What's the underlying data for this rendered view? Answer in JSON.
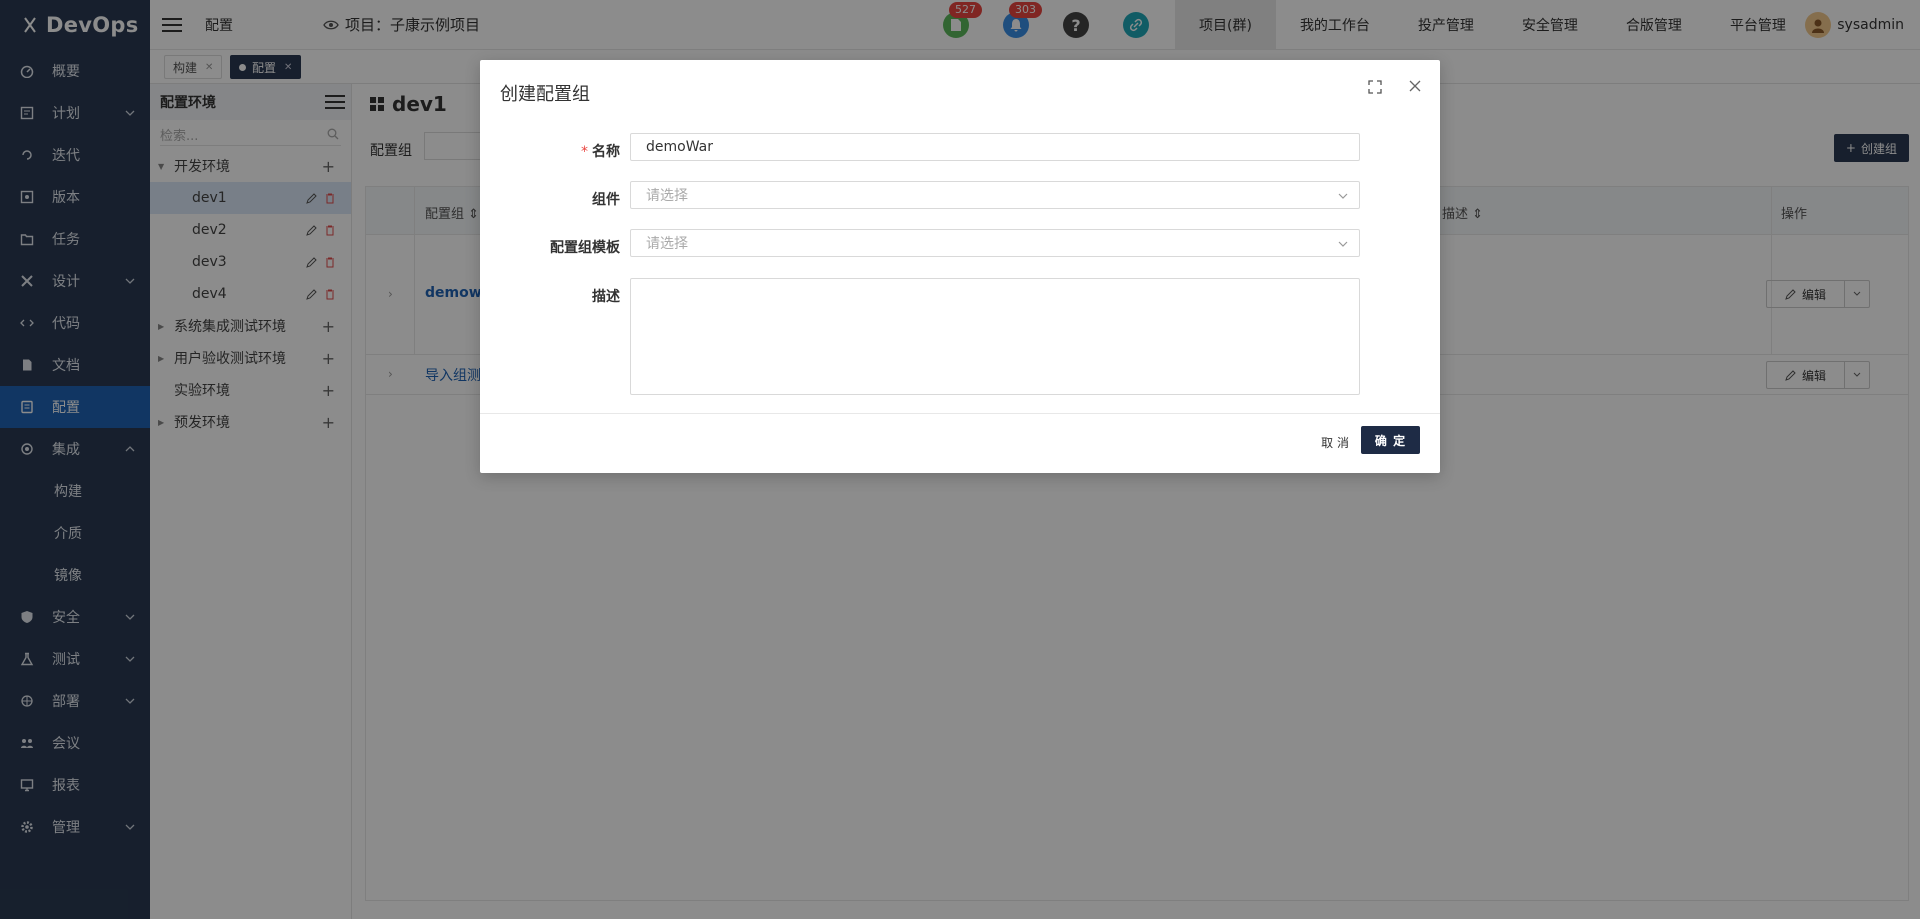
{
  "brand": {
    "name": "DevOps"
  },
  "sidebar": {
    "items": [
      {
        "label": "概要",
        "icon": "dashboard-icon"
      },
      {
        "label": "计划",
        "icon": "plan-icon",
        "has_children": true
      },
      {
        "label": "迭代",
        "icon": "iteration-icon"
      },
      {
        "label": "版本",
        "icon": "version-icon"
      },
      {
        "label": "任务",
        "icon": "task-icon"
      },
      {
        "label": "设计",
        "icon": "design-icon",
        "has_children": true
      },
      {
        "label": "代码",
        "icon": "code-icon"
      },
      {
        "label": "文档",
        "icon": "document-icon"
      },
      {
        "label": "配置",
        "icon": "config-icon",
        "active": true
      },
      {
        "label": "集成",
        "icon": "integration-icon",
        "expanded": true
      },
      {
        "label": "构建",
        "sub": true
      },
      {
        "label": "介质",
        "sub": true
      },
      {
        "label": "镜像",
        "sub": true
      },
      {
        "label": "安全",
        "icon": "shield-icon",
        "has_children": true
      },
      {
        "label": "测试",
        "icon": "flask-icon",
        "has_children": true
      },
      {
        "label": "部署",
        "icon": "deploy-icon",
        "has_children": true
      },
      {
        "label": "会议",
        "icon": "meeting-icon"
      },
      {
        "label": "报表",
        "icon": "report-icon"
      },
      {
        "label": "管理",
        "icon": "gear-icon",
        "has_children": true
      }
    ]
  },
  "topbar": {
    "breadcrumb": "配置",
    "project": "项目：子康示例项目",
    "badges": {
      "docs": "527",
      "notifications": "303"
    },
    "menu": [
      "项目(群)",
      "我的工作台",
      "投产管理",
      "安全管理",
      "合版管理",
      "平台管理"
    ],
    "user": "sysadmin"
  },
  "tabs": [
    {
      "label": "构建",
      "active": false
    },
    {
      "label": "配置",
      "active": true
    }
  ],
  "tree": {
    "title": "配置环境",
    "search_placeholder": "检索...",
    "nodes": [
      {
        "label": "开发环境",
        "expanded": true,
        "children": [
          "dev1",
          "dev2",
          "dev3",
          "dev4"
        ]
      },
      {
        "label": "系统集成测试环境"
      },
      {
        "label": "用户验收测试环境"
      },
      {
        "label": "实验环境"
      },
      {
        "label": "预发环境"
      }
    ]
  },
  "main": {
    "title": "dev1",
    "filter_label": "配置组",
    "create_button": "创建组",
    "columns": [
      "配置组",
      "描述",
      "操作"
    ],
    "rows": [
      {
        "name": "demowa",
        "action": "编辑"
      },
      {
        "name": "导入组测",
        "action": "编辑"
      }
    ]
  },
  "modal": {
    "title": "创建配置组",
    "fields": {
      "name_label": "名称",
      "name_value": "demoWar",
      "component_label": "组件",
      "component_placeholder": "请选择",
      "template_label": "配置组模板",
      "template_placeholder": "请选择",
      "desc_label": "描述"
    },
    "cancel": "取 消",
    "ok": "确 定"
  },
  "colors": {
    "sidebar": "#2a3a52",
    "active": "#1f63b5",
    "primary_button": "#1e2b45"
  }
}
